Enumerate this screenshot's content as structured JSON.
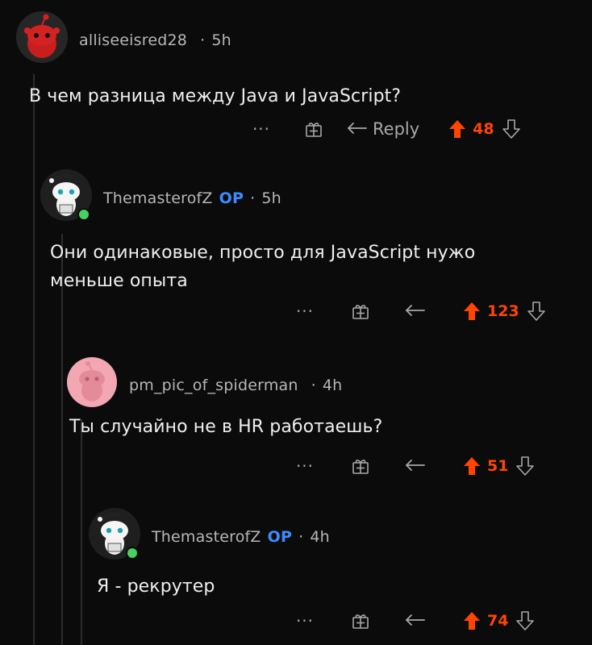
{
  "colors": {
    "background": "#0b0b0b",
    "upvote": "#ff4500",
    "op_badge": "#3b8dff",
    "meta": "#b7b7b7",
    "icon": "#a8a8a8"
  },
  "comments": [
    {
      "username": "alliseeisred28",
      "op": "",
      "time": "5h",
      "text": "В чем разница между Java и JavaScript?",
      "more": "···",
      "reply_label": "Reply",
      "score": "48",
      "avatar_icon": "red-snoo-avatar-icon"
    },
    {
      "username": "ThemasterofZ",
      "op": "OP",
      "time": "5h",
      "text": "Они одинаковые, просто для JavaScript нужо меньше опыта",
      "more": "···",
      "reply_label": "",
      "score": "123",
      "avatar_icon": "snoo-avatar-icon"
    },
    {
      "username": "pm_pic_of_spiderman",
      "op": "",
      "time": "4h",
      "text": "Ты случайно не в HR работаешь?",
      "more": "···",
      "reply_label": "",
      "score": "51",
      "avatar_icon": "pink-snoo-avatar-icon"
    },
    {
      "username": "ThemasterofZ",
      "op": "OP",
      "time": "4h",
      "text": "Я - рекрутер",
      "more": "···",
      "reply_label": "",
      "score": "74",
      "avatar_icon": "snoo-avatar-icon"
    }
  ]
}
